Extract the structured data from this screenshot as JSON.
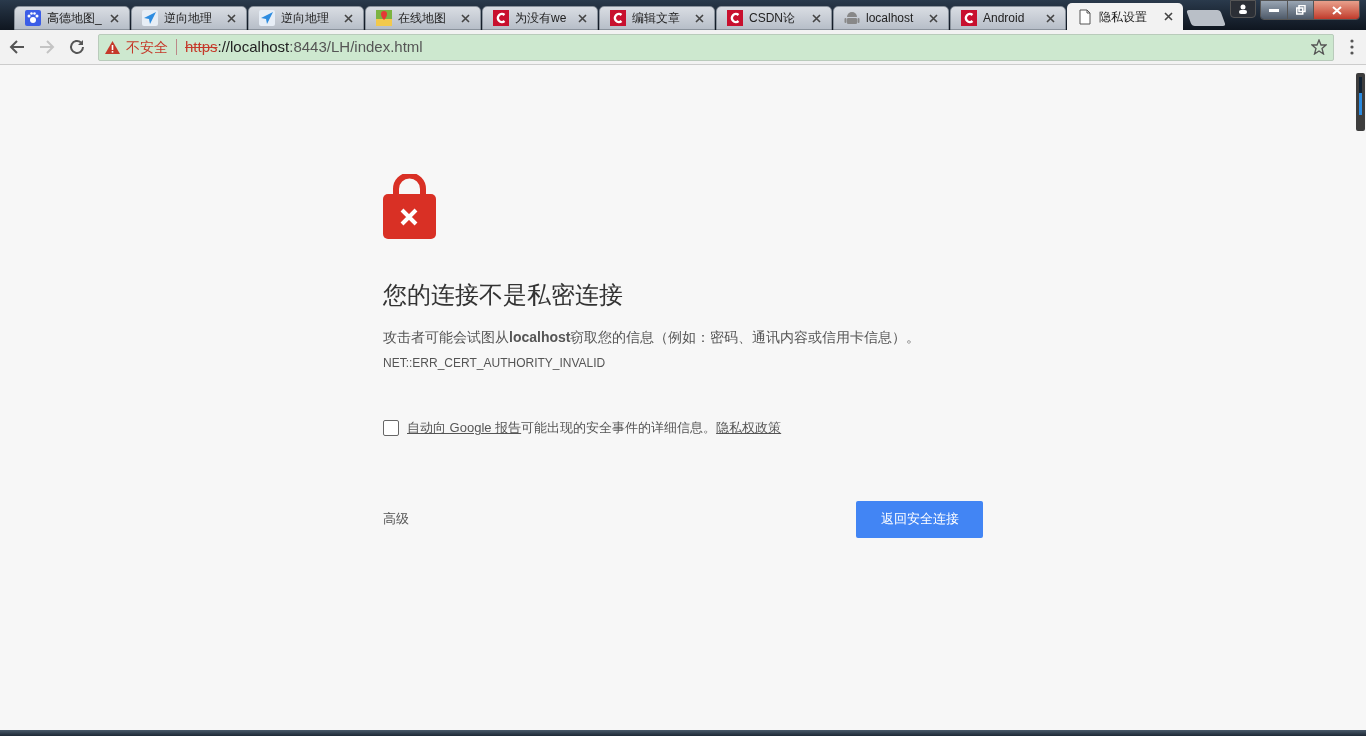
{
  "tabs": [
    {
      "title": "高德地图_",
      "kind": "paw",
      "selected": false
    },
    {
      "title": "逆向地理",
      "kind": "arrow",
      "selected": false
    },
    {
      "title": "逆向地理",
      "kind": "arrow",
      "selected": false
    },
    {
      "title": "在线地图",
      "kind": "map",
      "selected": false
    },
    {
      "title": "为没有we",
      "kind": "c",
      "selected": false
    },
    {
      "title": "编辑文章",
      "kind": "c",
      "selected": false
    },
    {
      "title": "CSDN论",
      "kind": "c",
      "selected": false
    },
    {
      "title": "localhost",
      "kind": "android",
      "selected": false
    },
    {
      "title": "Android",
      "kind": "c",
      "selected": false
    },
    {
      "title": "隐私设置",
      "kind": "page",
      "selected": true
    }
  ],
  "address_bar": {
    "security_label": "不安全",
    "scheme": "https",
    "rest_host": "://localhost",
    "rest_path": ":8443/LH/index.html"
  },
  "error_page": {
    "heading": "您的连接不是私密连接",
    "message": "攻击者可能会试图从**localhost**窃取您的信息（例如：密码、通讯内容或信用卡信息）。",
    "error_code": "NET::ERR_CERT_AUTHORITY_INVALID",
    "report": {
      "checked": false,
      "link": "自动向 Google 报告",
      "text": "可能出现的安全事件的详细信息。",
      "privacy_link": "隐私权政策"
    },
    "advanced": "高级",
    "back_button": "返回安全连接"
  }
}
